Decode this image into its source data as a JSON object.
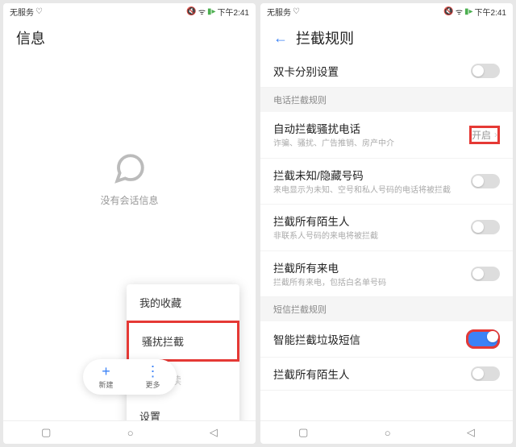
{
  "status": {
    "carrier": "无服务",
    "time": "下午2:41"
  },
  "screen1": {
    "title": "信息",
    "empty": "没有会话信息",
    "menu": {
      "fav": "我的收藏",
      "block": "骚扰拦截",
      "read": "全部已读",
      "settings": "设置"
    },
    "bottom": {
      "new": "新建",
      "more": "更多"
    }
  },
  "screen2": {
    "title": "拦截规则",
    "dual_sim": "双卡分别设置",
    "section_call": "电话拦截规则",
    "auto_block": {
      "title": "自动拦截骚扰电话",
      "sub": "诈骗、骚扰、广告推销、房产中介",
      "value": "开启"
    },
    "unknown": {
      "title": "拦截未知/隐藏号码",
      "sub": "来电显示为未知、空号和私人号码的电话将被拦截"
    },
    "strangers": {
      "title": "拦截所有陌生人",
      "sub": "非联系人号码的来电将被拦截"
    },
    "all_calls": {
      "title": "拦截所有来电",
      "sub": "拦截所有来电，包括白名单号码"
    },
    "section_sms": "短信拦截规则",
    "smart_sms": "智能拦截垃圾短信",
    "sms_strangers": "拦截所有陌生人"
  }
}
